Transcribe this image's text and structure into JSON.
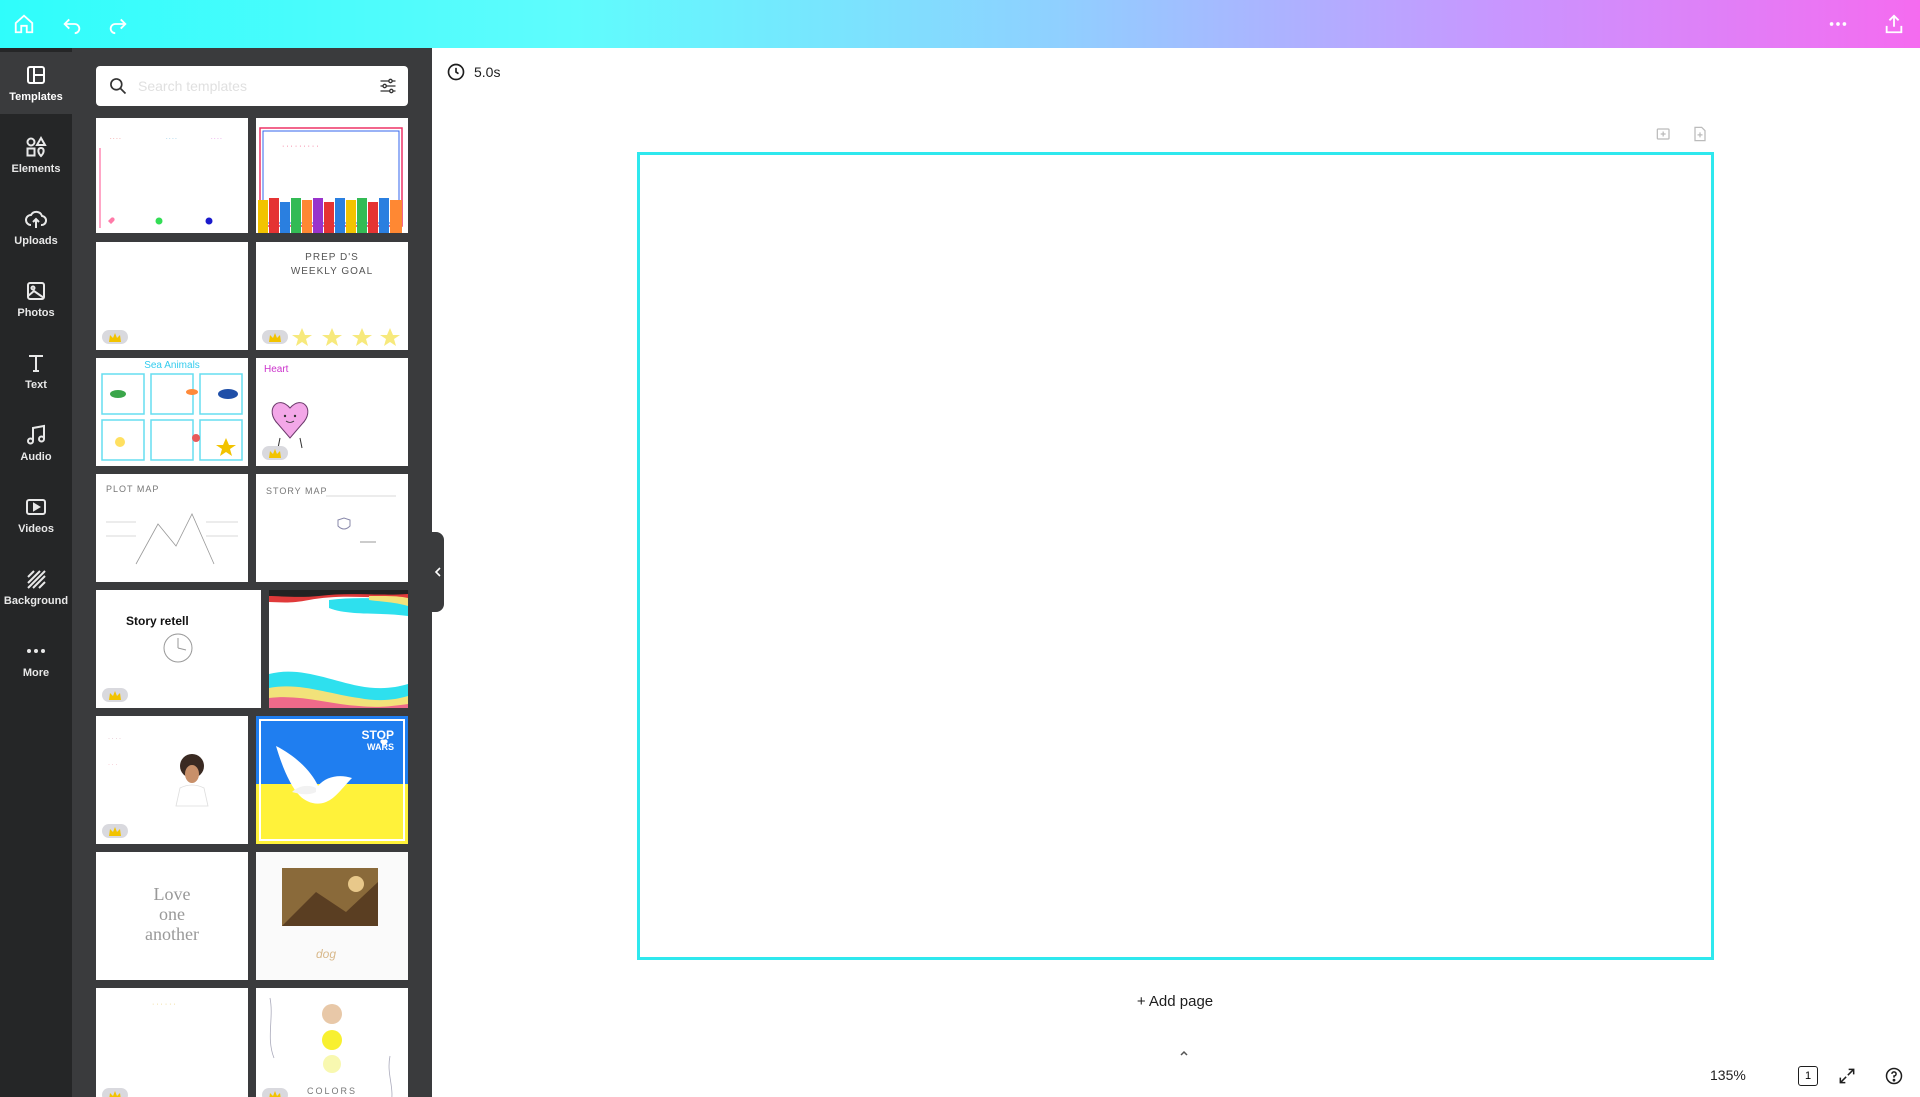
{
  "topbar": {
    "icons": [
      "home-icon",
      "undo-icon",
      "redo-icon",
      "more-icon",
      "share-icon"
    ]
  },
  "rail": {
    "items": [
      {
        "label": "Templates",
        "icon": "templates-icon"
      },
      {
        "label": "Elements",
        "icon": "elements-icon"
      },
      {
        "label": "Uploads",
        "icon": "uploads-icon"
      },
      {
        "label": "Photos",
        "icon": "photos-icon"
      },
      {
        "label": "Text",
        "icon": "text-icon"
      },
      {
        "label": "Audio",
        "icon": "audio-icon"
      },
      {
        "label": "Videos",
        "icon": "videos-icon"
      },
      {
        "label": "Background",
        "icon": "background-icon"
      },
      {
        "label": "More",
        "icon": "more-icon"
      }
    ]
  },
  "panel": {
    "search_placeholder": "Search templates",
    "thumbnails": {
      "t4_title": "PREP D'S",
      "t4_sub": "WEEKLY GOAL",
      "t5_title": "Sea Animals",
      "t6_title": "Heart",
      "t7_title": "PLOT MAP",
      "t8_title": "STORY MAP",
      "t9_title": "Story retell",
      "t12_title": "STOP",
      "t12_sub": "WARS",
      "t13_line1": "Love",
      "t13_line2": "one",
      "t13_line3": "another",
      "t16_title": "COLORS"
    }
  },
  "canvas": {
    "duration": "5.0s",
    "add_page": "+ Add page"
  },
  "footer": {
    "zoom": "135%",
    "page_number": "1"
  },
  "colors": {
    "rail_bg": "#252627",
    "panel_bg": "#3a3b3d",
    "page_border": "#2ee8ee"
  }
}
